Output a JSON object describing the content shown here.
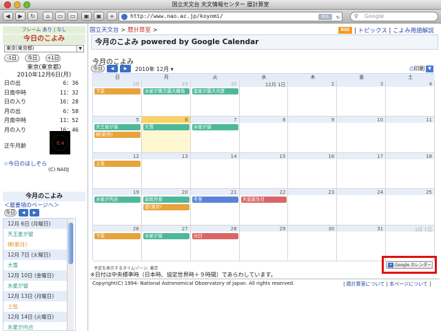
{
  "window": {
    "title": "国立天文台 天文情報センター 暦計算室"
  },
  "toolbar": {
    "back": "◀",
    "forward": "▶",
    "reload": "↻",
    "home": "⌂",
    "url": "http://www.nao.ac.jp/koyomi/",
    "add": "+",
    "rss": "RSS",
    "search_placeholder": "Google"
  },
  "sidebar": {
    "frame": {
      "label": "フレーム",
      "on": "あり",
      "sep": "|",
      "off": "なし"
    },
    "heading": "今日のこよみ",
    "location_select": "東京(東京都)",
    "nav": {
      "prev": "-1日",
      "today": "今日",
      "next": "+1日"
    },
    "place": "東京(東京都)",
    "date": "2010年12月6日(月)",
    "ephemeris": [
      {
        "label": "日の出",
        "value": "6：36"
      },
      {
        "label": "日南中時",
        "value": "11：32"
      },
      {
        "label": "日の入り",
        "value": "16：28"
      },
      {
        "label": "月の出",
        "value": "6：58"
      },
      {
        "label": "月南中時",
        "value": "11：52"
      },
      {
        "label": "月の入り",
        "value": "16：46"
      }
    ],
    "moon_age_label": "正午月齢",
    "moon_age": "0.4",
    "stars_link": "☆今日のほしぞら",
    "copyright": "(C) NAOJ",
    "calendar_heading": "今月のこよみ",
    "calendar_link": "＜暦要項のページへ＞",
    "mini_today": "今日",
    "events": [
      {
        "type": "date",
        "text": "12月 6日 (月曜日)"
      },
      {
        "type": "event",
        "text": "天王星が留"
      },
      {
        "type": "event2",
        "text": "朔(新月)"
      },
      {
        "type": "date",
        "text": "12月 7日 (火曜日)"
      },
      {
        "type": "event",
        "text": "大雪"
      },
      {
        "type": "date",
        "text": "12月 10日 (金曜日)"
      },
      {
        "type": "event",
        "text": "水星が留"
      },
      {
        "type": "date",
        "text": "12月 13日 (月曜日)"
      },
      {
        "type": "event2",
        "text": "上弦"
      },
      {
        "type": "date",
        "text": "12月 14日 (火曜日)"
      },
      {
        "type": "event",
        "text": "水星が内合"
      }
    ]
  },
  "main": {
    "breadcrumb": {
      "home": "国立天文台",
      "sep": ">",
      "current": "暦計算室",
      "sep2": ">"
    },
    "rss": "RSS",
    "topnav": {
      "topics": "トピックス",
      "sep": "|",
      "glossary": "こよみ用語解説"
    },
    "page_title": "今月のこよみ powered by Google Calendar",
    "calendar": {
      "title": "今月のこよみ",
      "today_btn": "今日",
      "month": "2010年 12月",
      "print": "印刷",
      "weekdays": [
        "日",
        "月",
        "火",
        "水",
        "木",
        "金",
        "土"
      ],
      "weeks": [
        {
          "days": [
            "28",
            "29",
            "30",
            "12月 1日",
            "2",
            "3",
            "4"
          ],
          "events": [
            {
              "col": 0,
              "row": 0,
              "span": 1,
              "text": "下弦",
              "color": "#e8a33c"
            },
            {
              "col": 1,
              "row": 0,
              "span": 1,
              "text": "水星が東方最大離角",
              "color": "#4fb89a"
            },
            {
              "col": 2,
              "row": 0,
              "span": 1,
              "text": "金星が最大光度",
              "color": "#4fb89a"
            }
          ]
        },
        {
          "days": [
            "5",
            "6",
            "7",
            "8",
            "9",
            "10",
            "11"
          ],
          "events": [
            {
              "col": 0,
              "row": 0,
              "span": 1,
              "text": "天王星が留",
              "color": "#4fb89a"
            },
            {
              "col": 1,
              "row": 0,
              "span": 1,
              "text": "大雪",
              "color": "#4fb89a"
            },
            {
              "col": 2,
              "row": 0,
              "span": 1,
              "text": "水星が留",
              "color": "#4fb89a"
            },
            {
              "col": 0,
              "row": 1,
              "span": 1,
              "text": "朔(新月)",
              "color": "#e8a33c"
            }
          ]
        },
        {
          "days": [
            "12",
            "13",
            "14",
            "15",
            "16",
            "17",
            "18"
          ],
          "events": [
            {
              "col": 0,
              "row": 0,
              "span": 1,
              "text": "上弦",
              "color": "#e8a33c"
            }
          ]
        },
        {
          "days": [
            "19",
            "20",
            "21",
            "22",
            "23",
            "24",
            "25"
          ],
          "events": [
            {
              "col": 0,
              "row": 0,
              "span": 1,
              "text": "水星が内合",
              "color": "#4fb89a"
            },
            {
              "col": 1,
              "row": 0,
              "span": 1,
              "text": "皆既月食",
              "color": "#4fb89a"
            },
            {
              "col": 2,
              "row": 0,
              "span": 1,
              "text": "冬至",
              "color": "#5b82d6"
            },
            {
              "col": 3,
              "row": 0,
              "span": 1,
              "text": "天皇誕生日",
              "color": "#d96666"
            },
            {
              "col": 1,
              "row": 1,
              "span": 1,
              "text": "望(満月)",
              "color": "#e8a33c"
            }
          ]
        },
        {
          "days": [
            "26",
            "27",
            "28",
            "29",
            "30",
            "31",
            "1月 1日"
          ],
          "events": [
            {
              "col": 0,
              "row": 0,
              "span": 1,
              "text": "下弦",
              "color": "#e8a33c"
            },
            {
              "col": 1,
              "row": 0,
              "span": 1,
              "text": "水星が留",
              "color": "#4fb89a"
            },
            {
              "col": 2,
              "row": 0,
              "span": 1,
              "text": "元日",
              "color": "#d96666"
            }
          ]
        }
      ],
      "today_col": 1,
      "today_week": 1,
      "timezone": "予定を表示するタイムゾーン: 東京",
      "gcal_badge": "Google カレンダー"
    },
    "note": "※日付は中央標準時（日本時、協定世界時＋９時間）であらわしています。",
    "footer": {
      "copyright": "Copyright(C) 1994- National Astronomical Observatory of Japan. All rights reserved.",
      "about": "暦計算室について",
      "sep": "|",
      "about_page": "本ページについて"
    }
  }
}
